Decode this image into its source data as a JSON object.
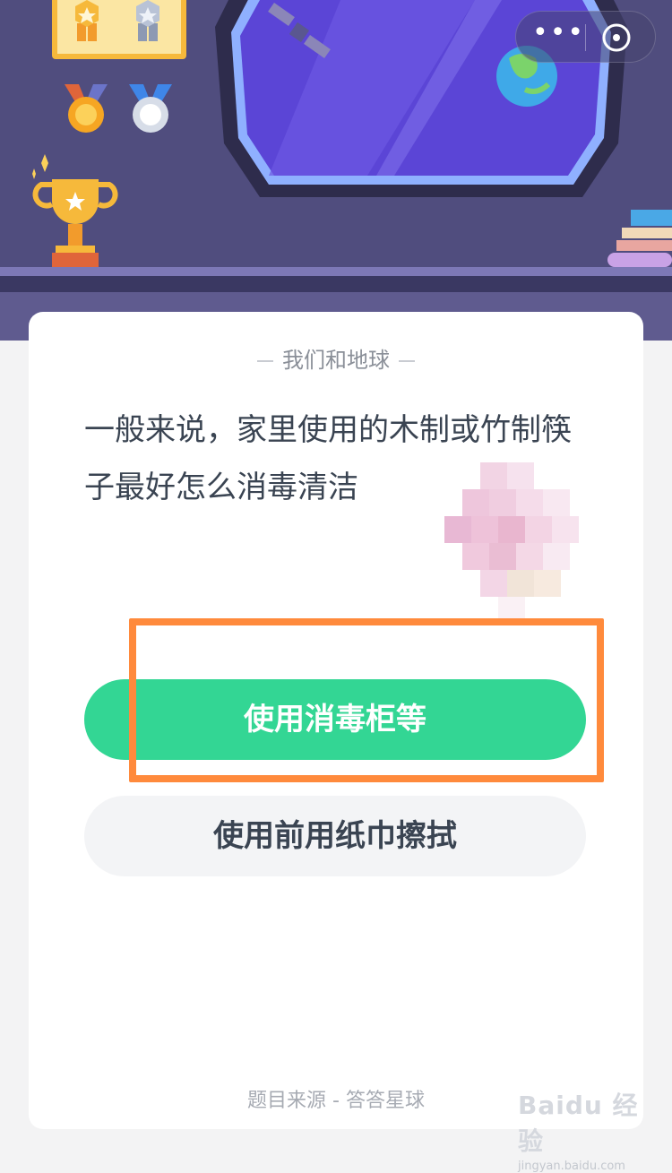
{
  "colors": {
    "accent": "#33d694",
    "highlight": "#ff8a3c",
    "scene_bg": "#504d7e",
    "card_bg": "#ffffff"
  },
  "header": {
    "more_icon": "more-dots-icon",
    "close_icon": "close-circle-icon",
    "more_label": "•••"
  },
  "quiz": {
    "category": "我们和地球",
    "question": "一般来说，家里使用的木制或竹制筷子最好怎么消毒清洁",
    "options": [
      {
        "label": "使用消毒柜等",
        "highlighted": true
      },
      {
        "label": "使用前用纸巾擦拭",
        "highlighted": false
      }
    ],
    "source": "题目来源 - 答答星球"
  },
  "watermark": {
    "main": "Baidu 经验",
    "sub": "jingyan.baidu.com"
  }
}
